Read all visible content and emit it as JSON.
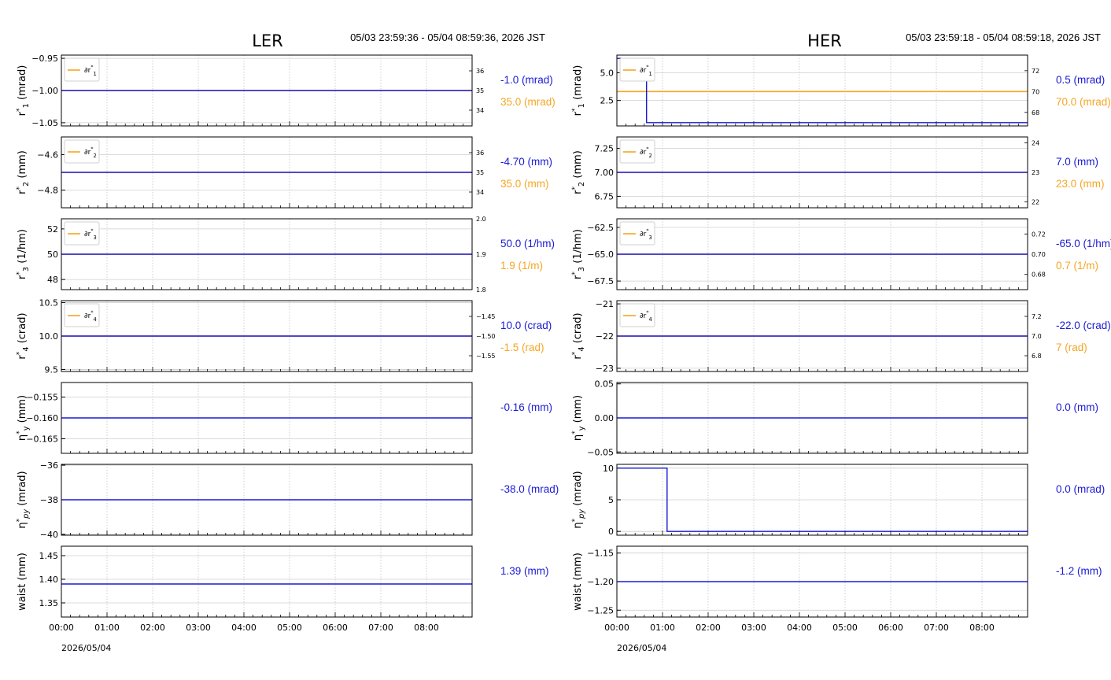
{
  "colors": {
    "primary": "#1a1ad6",
    "secondary": "#f5a623",
    "grid": "#cfcfcf"
  },
  "chart_data": [
    {
      "type": "line",
      "title": "LER",
      "time_range": "05/03 23:59:36 - 05/04 08:59:36, 2026 JST",
      "date_label": "2026/05/04",
      "x_ticks": [
        "00:00",
        "01:00",
        "02:00",
        "03:00",
        "04:00",
        "05:00",
        "06:00",
        "07:00",
        "08:00"
      ],
      "xlim": [
        0,
        9
      ],
      "panels": [
        {
          "ylabel": "r*1 (mrad)",
          "ylim": [
            -1.055,
            -0.945
          ],
          "yticks": [
            -1.05,
            -1.0,
            -0.95
          ],
          "ytick_labels": [
            "−1.05",
            "−1.00",
            "−0.95"
          ],
          "series": [
            {
              "x": [
                0,
                9
              ],
              "y": [
                -1.0,
                -1.0
              ]
            }
          ],
          "legend": "∂r*1",
          "series2": {
            "x": [
              0,
              9
            ],
            "y": [
              35,
              35
            ]
          },
          "ylim2": [
            33.2,
            36.8
          ],
          "yticks2": [
            34,
            35,
            36
          ],
          "ytick_labels2": [
            "34",
            "35",
            "36"
          ],
          "value1": "-1.0 (mrad)",
          "value2": "35.0 (mrad)"
        },
        {
          "ylabel": "r*2 (mm)",
          "ylim": [
            -4.9,
            -4.5
          ],
          "yticks": [
            -4.8,
            -4.6
          ],
          "ytick_labels": [
            "−4.8",
            "−4.6"
          ],
          "series": [
            {
              "x": [
                0,
                9
              ],
              "y": [
                -4.7,
                -4.7
              ]
            }
          ],
          "legend": "∂r*2",
          "series2": {
            "x": [
              0,
              9
            ],
            "y": [
              35,
              35
            ]
          },
          "ylim2": [
            33.2,
            36.8
          ],
          "yticks2": [
            34,
            35,
            36
          ],
          "ytick_labels2": [
            "34",
            "35",
            "36"
          ],
          "value1": "-4.70 (mm)",
          "value2": "35.0 (mm)"
        },
        {
          "ylabel": "r*3 (1/hm)",
          "ylim": [
            47.2,
            52.8
          ],
          "yticks": [
            48,
            50,
            52
          ],
          "ytick_labels": [
            "48",
            "50",
            "52"
          ],
          "series": [
            {
              "x": [
                0,
                9
              ],
              "y": [
                50,
                50
              ]
            }
          ],
          "legend": "∂r*3",
          "series2": {
            "x": [
              0,
              9
            ],
            "y": [
              1.9,
              1.9
            ]
          },
          "ylim2": [
            1.8,
            2.0
          ],
          "yticks2": [
            1.8,
            1.9,
            2.0
          ],
          "ytick_labels2": [
            "1.8",
            "1.9",
            "2.0"
          ],
          "value1": "50.0 (1/hm)",
          "value2": "1.9 (1/m)"
        },
        {
          "ylabel": "r*4 (crad)",
          "ylim": [
            9.47,
            10.53
          ],
          "yticks": [
            9.5,
            10.0,
            10.5
          ],
          "ytick_labels": [
            "9.5",
            "10.0",
            "10.5"
          ],
          "series": [
            {
              "x": [
                0,
                9
              ],
              "y": [
                10,
                10
              ]
            }
          ],
          "legend": "∂r*4",
          "series2": {
            "x": [
              0,
              9
            ],
            "y": [
              -1.5,
              -1.5
            ]
          },
          "ylim2": [
            -1.59,
            -1.41
          ],
          "yticks2": [
            -1.55,
            -1.5,
            -1.45
          ],
          "ytick_labels2": [
            "−1.55",
            "−1.50",
            "−1.45"
          ],
          "value1": "10.0 (crad)",
          "value2": "-1.5 (rad)"
        },
        {
          "ylabel": "η*y (mm)",
          "ylim": [
            -0.1685,
            -0.1515
          ],
          "yticks": [
            -0.165,
            -0.16,
            -0.155
          ],
          "ytick_labels": [
            "−0.165",
            "−0.160",
            "−0.155"
          ],
          "series": [
            {
              "x": [
                0,
                9
              ],
              "y": [
                -0.16,
                -0.16
              ]
            }
          ],
          "value1": "-0.16 (mm)"
        },
        {
          "ylabel": "η*py (mrad)",
          "ylim": [
            -40.05,
            -35.95
          ],
          "yticks": [
            -40,
            -38,
            -36
          ],
          "ytick_labels": [
            "−40",
            "−38",
            "−36"
          ],
          "series": [
            {
              "x": [
                0,
                9
              ],
              "y": [
                -38,
                -38
              ]
            }
          ],
          "value1": "-38.0 (mrad)"
        },
        {
          "ylabel": "waist (mm)",
          "ylim": [
            1.32,
            1.47
          ],
          "yticks": [
            1.35,
            1.4,
            1.45
          ],
          "ytick_labels": [
            "1.35",
            "1.40",
            "1.45"
          ],
          "series": [
            {
              "x": [
                0,
                9
              ],
              "y": [
                1.39,
                1.39
              ]
            }
          ],
          "value1": "1.39 (mm)"
        }
      ]
    },
    {
      "type": "line",
      "title": "HER",
      "time_range": "05/03 23:59:18 - 05/04 08:59:18, 2026 JST",
      "date_label": "2026/05/04",
      "x_ticks": [
        "00:00",
        "01:00",
        "02:00",
        "03:00",
        "04:00",
        "05:00",
        "06:00",
        "07:00",
        "08:00"
      ],
      "xlim": [
        0,
        9
      ],
      "panels": [
        {
          "ylabel": "r*1 (mrad)",
          "ylim": [
            0.2,
            6.6
          ],
          "yticks": [
            2.5,
            5.0
          ],
          "ytick_labels": [
            "2.5",
            "5.0"
          ],
          "series": [
            {
              "x": [
                0,
                0.65,
                0.65,
                9
              ],
              "y": [
                6.3,
                6.3,
                0.5,
                0.5
              ]
            }
          ],
          "legend": "∂r*1",
          "series2": {
            "x": [
              0,
              9
            ],
            "y": [
              70,
              70
            ]
          },
          "ylim2": [
            66.7,
            73.5
          ],
          "yticks2": [
            68,
            70,
            72
          ],
          "ytick_labels2": [
            "68",
            "70",
            "72"
          ],
          "value1": "0.5 (mrad)",
          "value2": "70.0 (mrad)"
        },
        {
          "ylabel": "r*2 (mm)",
          "ylim": [
            6.63,
            7.37
          ],
          "yticks": [
            6.75,
            7.0,
            7.25
          ],
          "ytick_labels": [
            "6.75",
            "7.00",
            "7.25"
          ],
          "series": [
            {
              "x": [
                0,
                9
              ],
              "y": [
                7.0,
                7.0
              ]
            }
          ],
          "legend": "∂r*2",
          "series2": {
            "x": [
              0,
              9
            ],
            "y": [
              23,
              23
            ]
          },
          "ylim2": [
            21.8,
            24.2
          ],
          "yticks2": [
            22,
            23,
            24
          ],
          "ytick_labels2": [
            "22",
            "23",
            "24"
          ],
          "value1": "7.0 (mm)",
          "value2": "23.0 (mm)"
        },
        {
          "ylabel": "r*3 (1/hm)",
          "ylim": [
            -68.3,
            -61.7
          ],
          "yticks": [
            -67.5,
            -65.0,
            -62.5
          ],
          "ytick_labels": [
            "−67.5",
            "−65.0",
            "−62.5"
          ],
          "series": [
            {
              "x": [
                0,
                9
              ],
              "y": [
                -65,
                -65
              ]
            }
          ],
          "legend": "∂r*3",
          "series2": {
            "x": [
              0,
              9
            ],
            "y": [
              0.7,
              0.7
            ]
          },
          "ylim2": [
            0.665,
            0.735
          ],
          "yticks2": [
            0.68,
            0.7,
            0.72
          ],
          "ytick_labels2": [
            "0.68",
            "0.70",
            "0.72"
          ],
          "value1": "-65.0 (1/hm)",
          "value2": "0.7 (1/m)"
        },
        {
          "ylabel": "r*4 (crad)",
          "ylim": [
            -23.1,
            -20.9
          ],
          "yticks": [
            -23,
            -22,
            -21
          ],
          "ytick_labels": [
            "−23",
            "−22",
            "−21"
          ],
          "series": [
            {
              "x": [
                0,
                9
              ],
              "y": [
                -22,
                -22
              ]
            }
          ],
          "legend": "∂r*4",
          "series2": {
            "x": [
              0,
              9
            ],
            "y": [
              7.0,
              7.0
            ]
          },
          "ylim2": [
            6.64,
            7.36
          ],
          "yticks2": [
            6.8,
            7.0,
            7.2
          ],
          "ytick_labels2": [
            "6.8",
            "7.0",
            "7.2"
          ],
          "value1": "-22.0 (crad)",
          "value2": "7 (rad)"
        },
        {
          "ylabel": "η*y (mm)",
          "ylim": [
            -0.052,
            0.052
          ],
          "yticks": [
            -0.05,
            0.0,
            0.05
          ],
          "ytick_labels": [
            "−0.05",
            "0.00",
            "0.05"
          ],
          "series": [
            {
              "x": [
                0,
                9
              ],
              "y": [
                0,
                0
              ]
            }
          ],
          "value1": "0.0 (mm)"
        },
        {
          "ylabel": "η*py (mrad)",
          "ylim": [
            -0.6,
            10.6
          ],
          "yticks": [
            0,
            5,
            10
          ],
          "ytick_labels": [
            "0",
            "5",
            "10"
          ],
          "series": [
            {
              "x": [
                0,
                1.1,
                1.1,
                9
              ],
              "y": [
                10,
                10,
                0,
                0
              ]
            }
          ],
          "value1": "0.0 (mrad)"
        },
        {
          "ylabel": "waist (mm)",
          "ylim": [
            -1.262,
            -1.138
          ],
          "yticks": [
            -1.25,
            -1.2,
            -1.15
          ],
          "ytick_labels": [
            "−1.25",
            "−1.20",
            "−1.15"
          ],
          "series": [
            {
              "x": [
                0,
                9
              ],
              "y": [
                -1.2,
                -1.2
              ]
            }
          ],
          "value1": "-1.2 (mm)"
        }
      ]
    }
  ]
}
